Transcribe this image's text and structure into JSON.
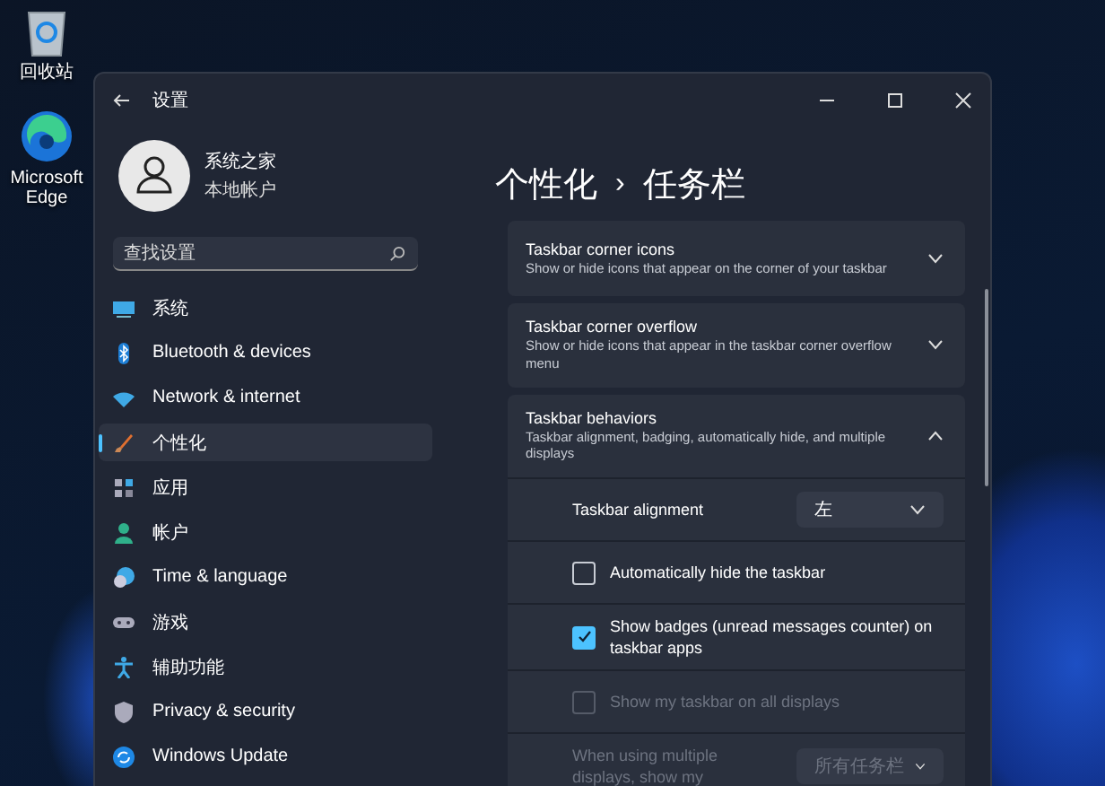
{
  "desktop_icons": [
    {
      "label": "回收站"
    },
    {
      "label": "Microsoft Edge"
    }
  ],
  "window": {
    "title": "设置"
  },
  "account": {
    "name": "系统之家",
    "type": "本地帐户"
  },
  "search": {
    "placeholder": "查找设置"
  },
  "nav": [
    {
      "label": "系统",
      "selected": false
    },
    {
      "label": "Bluetooth & devices",
      "selected": false
    },
    {
      "label": "Network & internet",
      "selected": false
    },
    {
      "label": "个性化",
      "selected": true
    },
    {
      "label": "应用",
      "selected": false
    },
    {
      "label": "帐户",
      "selected": false
    },
    {
      "label": "Time & language",
      "selected": false
    },
    {
      "label": "游戏",
      "selected": false
    },
    {
      "label": "辅助功能",
      "selected": false
    },
    {
      "label": "Privacy & security",
      "selected": false
    },
    {
      "label": "Windows Update",
      "selected": false
    }
  ],
  "breadcrumb": {
    "parent": "个性化",
    "separator": "›",
    "current": "任务栏"
  },
  "sections": [
    {
      "title": "Taskbar corner icons",
      "description": "Show or hide icons that appear on the corner of your taskbar",
      "expanded": false
    },
    {
      "title": "Taskbar corner overflow",
      "description": "Show or hide icons that appear in the taskbar corner overflow menu",
      "expanded": false
    },
    {
      "title": "Taskbar behaviors",
      "description": "Taskbar alignment, badging, automatically hide, and multiple displays",
      "expanded": true,
      "settings": [
        {
          "kind": "dropdown",
          "label": "Taskbar alignment",
          "value": "左",
          "disabled": false
        },
        {
          "kind": "checkbox",
          "label": "Automatically hide the taskbar",
          "checked": false,
          "disabled": false
        },
        {
          "kind": "checkbox",
          "label": "Show badges (unread messages counter) on taskbar apps",
          "checked": true,
          "disabled": false
        },
        {
          "kind": "checkbox",
          "label": "Show my taskbar on all displays",
          "checked": false,
          "disabled": true
        },
        {
          "kind": "dropdown",
          "label": "When using multiple displays, show my",
          "value": "所有任务栏",
          "disabled": true
        }
      ]
    }
  ]
}
